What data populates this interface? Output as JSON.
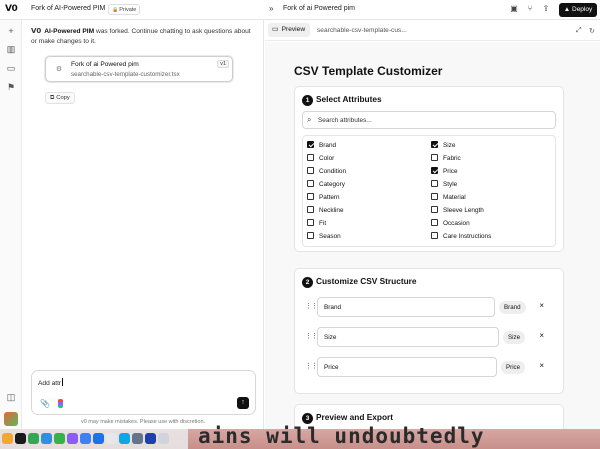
{
  "app": {
    "logo": "V0",
    "project_title": "Fork of AI-Powered PIM",
    "privacy_badge": "Private",
    "panel_title": "Fork of ai Powered pim",
    "deploy_label": "Deploy"
  },
  "chat": {
    "message_bold": "AI-Powered PIM",
    "message_text": " was forked. Continue chatting to ask questions about or make changes to it.",
    "file_card": {
      "name": "Fork of ai Powered pim",
      "path": "searchable-csv-template-customizer.tsx",
      "version": "v1"
    },
    "copy_label": "Copy",
    "composer_value": "Add attr",
    "disclaimer": "v0 may make mistakes. Please use with discretion."
  },
  "preview_tabs": {
    "active": "Preview",
    "file": "searchable-csv-template-cus..."
  },
  "page": {
    "title": "CSV Template Customizer",
    "sections": [
      {
        "num": "1",
        "title": "Select Attributes"
      },
      {
        "num": "2",
        "title": "Customize CSV Structure"
      },
      {
        "num": "3",
        "title": "Preview and Export"
      }
    ],
    "search_placeholder": "Search attributes...",
    "attributes_left": [
      {
        "label": "Brand",
        "checked": true
      },
      {
        "label": "Color",
        "checked": false
      },
      {
        "label": "Condition",
        "checked": false
      },
      {
        "label": "Category",
        "checked": false
      },
      {
        "label": "Pattern",
        "checked": false
      },
      {
        "label": "Neckline",
        "checked": false
      },
      {
        "label": "Fit",
        "checked": false
      },
      {
        "label": "Season",
        "checked": false
      }
    ],
    "attributes_right": [
      {
        "label": "Size",
        "checked": true
      },
      {
        "label": "Fabric",
        "checked": false
      },
      {
        "label": "Price",
        "checked": true
      },
      {
        "label": "Style",
        "checked": false
      },
      {
        "label": "Material",
        "checked": false
      },
      {
        "label": "Sleeve Length",
        "checked": false
      },
      {
        "label": "Occasion",
        "checked": false
      },
      {
        "label": "Care Instructions",
        "checked": false
      }
    ],
    "structure_rows": [
      {
        "value": "Brand",
        "tag": "Brand"
      },
      {
        "value": "Size",
        "tag": "Size"
      },
      {
        "value": "Price",
        "tag": "Price"
      }
    ],
    "remove_symbol": "×"
  },
  "dock": {
    "background_text": "ains will undoubtedly"
  }
}
